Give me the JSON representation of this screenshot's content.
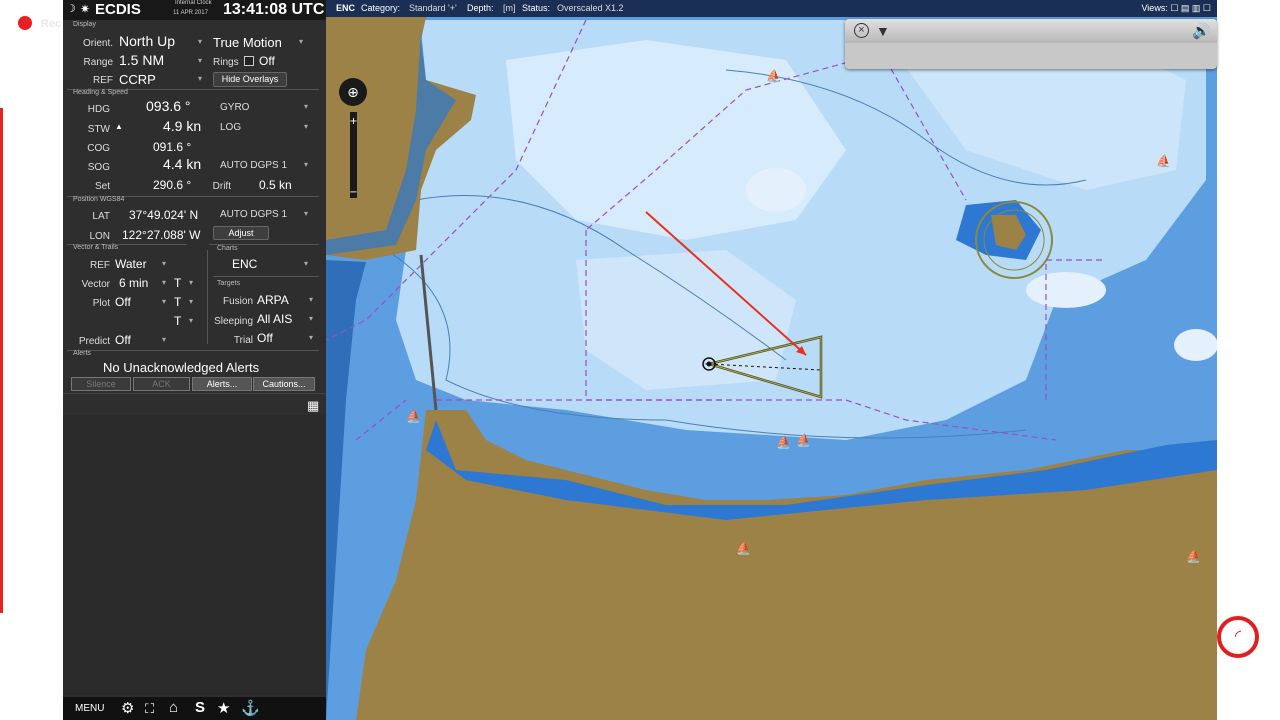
{
  "recording": {
    "label": "Rec"
  },
  "app": {
    "title": "ECDIS",
    "clock_label": "Internal Clock",
    "date": "11 APR 2017",
    "time": "13:41:08 UTC"
  },
  "display": {
    "section": "Display",
    "orient_label": "Orient.",
    "orient_value": "North Up",
    "motion_value": "True Motion",
    "range_label": "Range",
    "range_value": "1.5 NM",
    "rings_label": "Rings",
    "rings_value": "Off",
    "ref_label": "REF",
    "ref_value": "CCRP",
    "hide_overlays": "Hide Overlays"
  },
  "heading_speed": {
    "section": "Heading & Speed",
    "hdg_label": "HDG",
    "hdg_value": "093.6 °",
    "hdg_source": "GYRO",
    "stw_label": "STW",
    "stw_value": "4.9 kn",
    "stw_source": "LOG",
    "cog_label": "COG",
    "cog_value": "091.6 °",
    "sog_label": "SOG",
    "sog_value": "4.4 kn",
    "sog_source": "AUTO DGPS 1",
    "set_label": "Set",
    "set_value": "290.6 °",
    "drift_label": "Drift",
    "drift_value": "0.5 kn"
  },
  "position": {
    "section": "Position WGS84",
    "lat_label": "LAT",
    "lat_value": "37°49.024' N",
    "lat_source": "AUTO DGPS 1",
    "lon_label": "LON",
    "lon_value": "122°27.088' W",
    "adjust": "Adjust"
  },
  "vector_trails": {
    "section": "Vector & Trails",
    "ref_label": "REF",
    "ref_value": "Water",
    "vector_label": "Vector",
    "vector_value": "6 min",
    "vector_t": "T",
    "plot_label": "Plot",
    "plot_value": "Off",
    "plot_t": "T",
    "extra_t": "T",
    "predict_label": "Predict",
    "predict_value": "Off"
  },
  "charts": {
    "section": "Charts",
    "value": "ENC"
  },
  "targets": {
    "section": "Targets",
    "fusion_label": "Fusion",
    "fusion_value": "ARPA",
    "sleeping_label": "Sleeping",
    "sleeping_value": "All AIS",
    "trial_label": "Trial",
    "trial_value": "Off"
  },
  "alerts": {
    "section": "Alerts",
    "status": "No Unacknowledged Alerts",
    "silence": "Silence",
    "ack": "ACK",
    "alerts_btn": "Alerts...",
    "cautions_btn": "Cautions..."
  },
  "bottombar": {
    "menu": "MENU",
    "icons": [
      "gear-icon",
      "fullscreen-icon",
      "home-icon",
      "s-icon",
      "star-icon",
      "ship-icon"
    ]
  },
  "chart_header": {
    "enc": "ENC",
    "category_label": "Category:",
    "category_value": "Standard '+'",
    "depth_label": "Depth:",
    "depth_value": "[m]",
    "status_label": "Status:",
    "status_value": "Overscaled X1.2",
    "views": "Views:"
  },
  "colors": {
    "land": "#9c8246",
    "deep_water": "#d7ecfb",
    "shallow_water": "#5f9fe0",
    "route_magenta": "#b064d8",
    "own_ship_vector": "#e8301f",
    "accent_red": "#e8201f"
  }
}
